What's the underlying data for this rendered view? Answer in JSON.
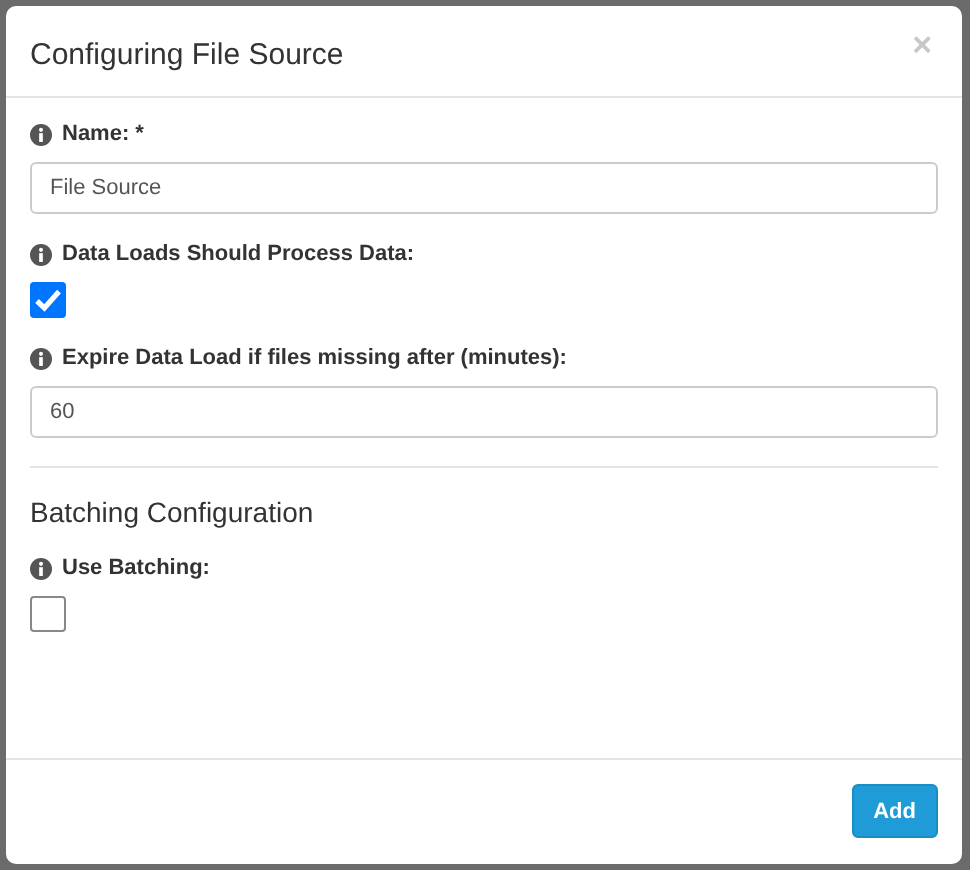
{
  "modal": {
    "title": "Configuring File Source",
    "close": "×"
  },
  "sections": [
    {
      "fields": [
        {
          "kind": "text",
          "label": "Name: *",
          "value": "File Source"
        },
        {
          "kind": "checkbox",
          "label": "Data Loads Should Process Data:",
          "checked": true
        },
        {
          "kind": "text",
          "label": "Expire Data Load if files missing after (minutes):",
          "value": "60"
        }
      ]
    },
    {
      "heading": "Batching Configuration",
      "fields": [
        {
          "kind": "checkbox",
          "label": "Use Batching:",
          "checked": false
        }
      ]
    }
  ],
  "buttons": [
    "Add"
  ]
}
